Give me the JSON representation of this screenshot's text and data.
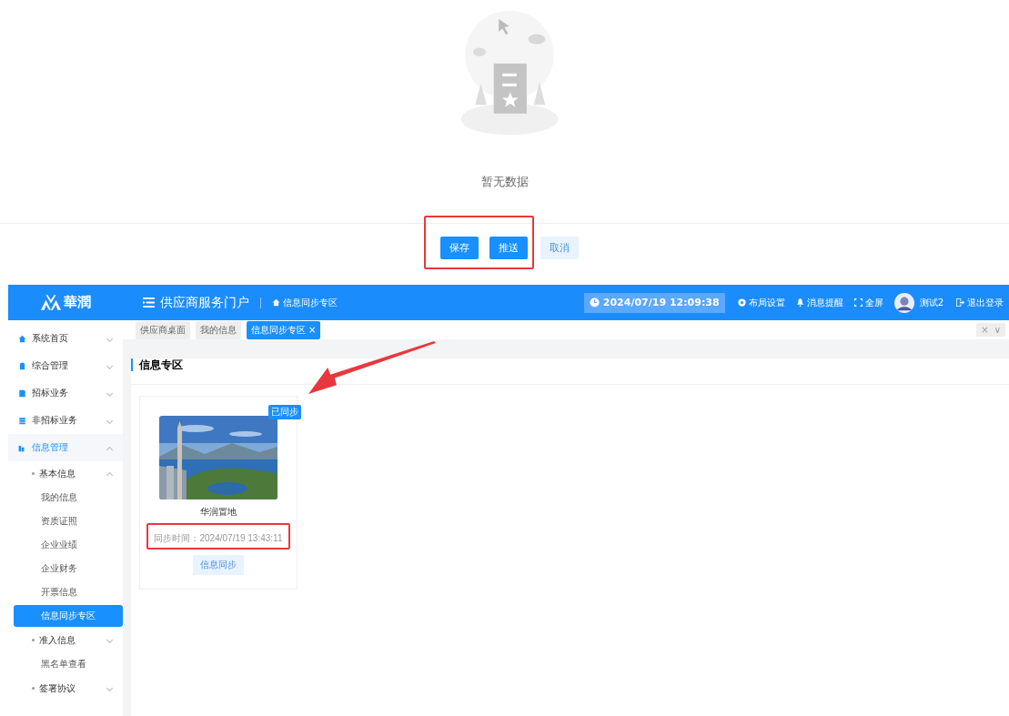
{
  "empty_state": {
    "message": "暂无数据"
  },
  "form_buttons": [
    {
      "label": "保存",
      "kind": "primary"
    },
    {
      "label": "推送",
      "kind": "primary"
    },
    {
      "label": "取消",
      "kind": "plain"
    }
  ],
  "header": {
    "logo_text": "華潤",
    "portal_title": "供应商服务门户",
    "breadcrumb": "信息同步专区",
    "clock": "2024/07/19 12:09:38",
    "actions": [
      {
        "label": "布局设置",
        "kind": "gear"
      },
      {
        "label": "消息提醒",
        "kind": "bell"
      },
      {
        "label": "全屏",
        "kind": "expand"
      }
    ],
    "user": "测试2",
    "logout": "退出登录"
  },
  "tabs": [
    {
      "label": "供应商桌面",
      "selected": false
    },
    {
      "label": "我的信息",
      "selected": false
    },
    {
      "label": "信息同步专区",
      "selected": true
    }
  ],
  "tab_controls": {
    "close": "×",
    "more": "∨"
  },
  "sidebar": {
    "items": [
      {
        "label": "系统首页",
        "expanded": false
      },
      {
        "label": "综合管理",
        "expanded": false
      },
      {
        "label": "招标业务",
        "expanded": false
      },
      {
        "label": "非招标业务",
        "expanded": false
      },
      {
        "label": "信息管理",
        "expanded": true,
        "children": [
          {
            "label": "基本信息",
            "expanded": true,
            "children": [
              {
                "label": "我的信息",
                "selected": false
              },
              {
                "label": "资质证照",
                "selected": false
              },
              {
                "label": "企业业绩",
                "selected": false
              },
              {
                "label": "企业财务",
                "selected": false
              },
              {
                "label": "开票信息",
                "selected": false
              },
              {
                "label": "信息同步专区",
                "selected": true
              }
            ]
          },
          {
            "label": "准入信息",
            "expanded": false,
            "children": [
              {
                "label": "黑名单查看",
                "selected": false
              }
            ]
          },
          {
            "label": "签署协议",
            "expanded": false
          }
        ]
      }
    ]
  },
  "panel": {
    "title": "信息专区",
    "cards": [
      {
        "badge": "已同步",
        "name": "华润置地",
        "sync_time": "同步时间：2024/07/19 13:43:11",
        "button": "信息同步"
      }
    ]
  }
}
